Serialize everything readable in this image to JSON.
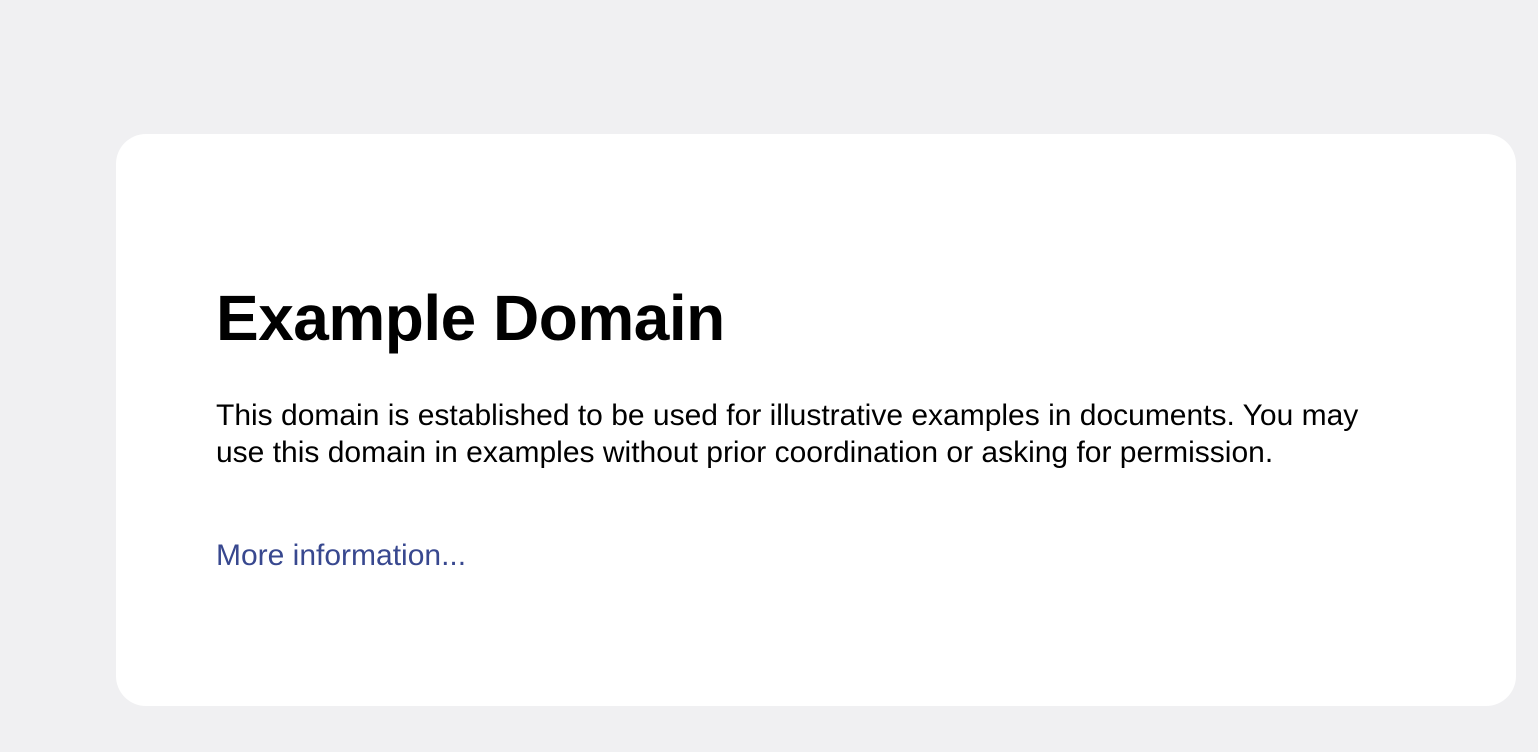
{
  "page": {
    "title": "Example Domain",
    "description": "This domain is established to be used for illustrative examples in documents. You may use this domain in examples without prior coordination or asking for permission.",
    "link_text": "More information..."
  },
  "colors": {
    "background": "#f0f0f2",
    "card": "#ffffff",
    "link": "#38488f"
  }
}
